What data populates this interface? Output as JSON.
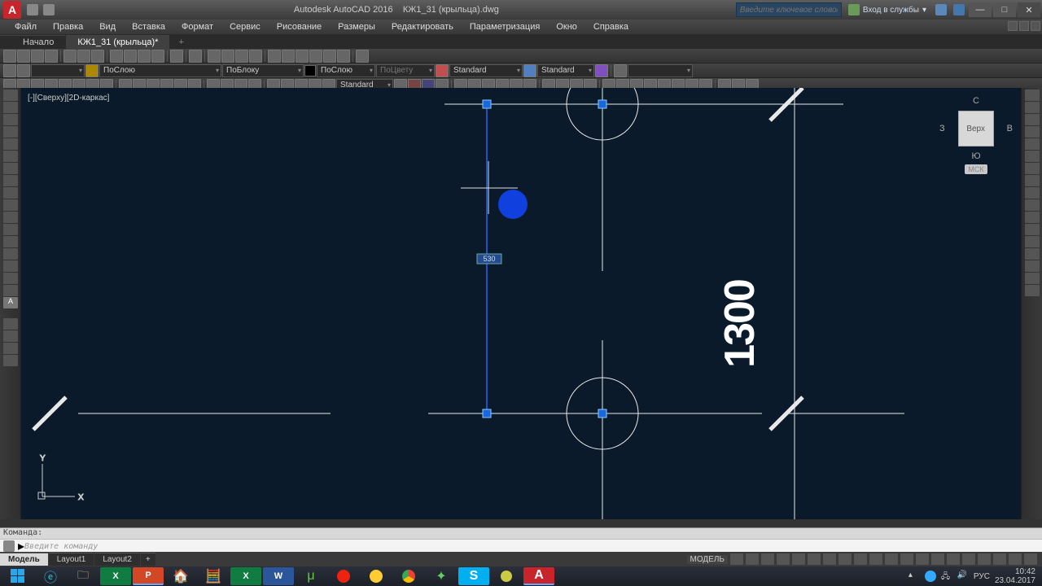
{
  "titlebar": {
    "app_initial": "A",
    "app_name": "Autodesk AutoCAD 2016",
    "doc_name": "КЖ1_31 (крыльца).dwg",
    "search_placeholder": "Введите ключевое слово/фразу",
    "signin": "Вход в службы",
    "min_glyph": "—",
    "max_glyph": "□",
    "close_glyph": "✕"
  },
  "menu": [
    "Файл",
    "Правка",
    "Вид",
    "Вставка",
    "Формат",
    "Сервис",
    "Рисование",
    "Размеры",
    "Редактировать",
    "Параметризация",
    "Окно",
    "Справка"
  ],
  "doc_tabs": {
    "start": "Начало",
    "active": "КЖ1_31 (крыльца)*",
    "plus": "+"
  },
  "combos": {
    "layer": "ПоСлою",
    "linetype": "ПоБлоку",
    "lineweight": "ПоСлою",
    "color": "ПоЦвету",
    "textstyle1": "Standard",
    "textstyle2": "Standard",
    "dimstyle": "Standard"
  },
  "view_label": "[-][Сверху][2D-каркас]",
  "dimension_value": "1300",
  "viewcube": {
    "n": "С",
    "e": "В",
    "s": "Ю",
    "w": "З",
    "face": "Верх",
    "wcs": "МСК"
  },
  "ucs": {
    "x": "X",
    "y": "Y"
  },
  "cmd": {
    "history": "Команда:",
    "prompt": "Введите команду"
  },
  "layout_tabs": [
    "Модель",
    "Layout1",
    "Layout2"
  ],
  "statusbar": {
    "model": "МОДЕЛЬ"
  },
  "tray": {
    "lang": "РУС",
    "time": "10:42",
    "date": "23.04.2017"
  },
  "grip_input": "530"
}
